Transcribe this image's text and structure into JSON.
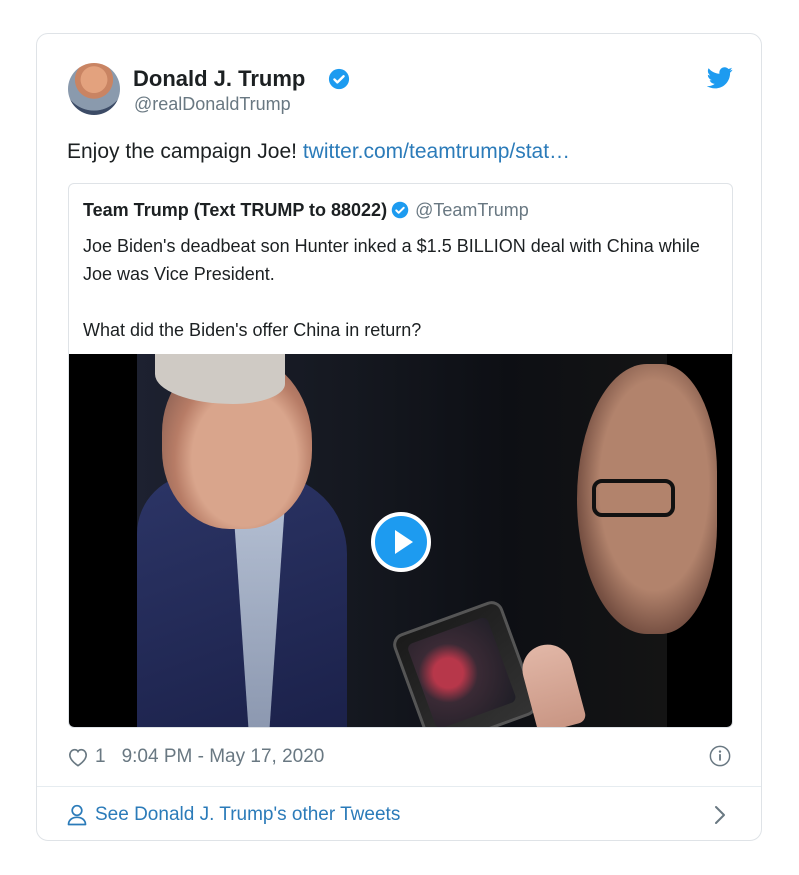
{
  "tweet": {
    "author_name": "Donald J. Trump",
    "author_handle": "@realDonaldTrump",
    "text": "Enjoy the campaign Joe! ",
    "link_text": "twitter.com/teamtrump/stat…",
    "likes": "1",
    "timestamp": "9:04 PM - May 17, 2020",
    "footer_link": "See Donald J. Trump's other Tweets"
  },
  "quoted": {
    "author_name": "Team Trump (Text TRUMP to 88022)",
    "author_handle": "@TeamTrump",
    "line1": "Joe Biden's deadbeat son Hunter inked a $1.5 BILLION deal with China while Joe was Vice President.",
    "line2": "What did the Biden's offer China in return?"
  },
  "colors": {
    "verified": "#1d9bf0",
    "link": "#2b7bb9",
    "muted": "#697882",
    "twitter_bird": "#1d9bf0"
  },
  "icons": [
    "verified-badge-icon",
    "twitter-bird-icon",
    "play-icon",
    "heart-icon",
    "info-icon",
    "person-icon",
    "chevron-right-icon"
  ]
}
